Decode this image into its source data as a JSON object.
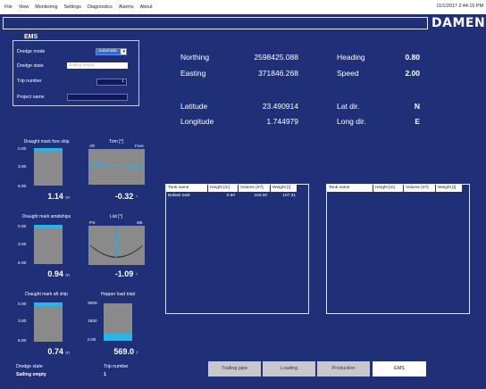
{
  "menu": {
    "items": [
      "File",
      "View",
      "Monitoring",
      "Settings",
      "Diagnostics",
      "Alarms",
      "About"
    ],
    "clock": "11/1/2017 2:44:15 PM"
  },
  "logo": {
    "text": "DAMEN"
  },
  "ems": {
    "title": "EMS",
    "dredge_mode_label": "Dredge mode",
    "dredge_mode_value": "Automatic",
    "dredge_state_label": "Dredge state",
    "dredge_state_value": "Sailing empty",
    "trip_number_label": "Trip number",
    "trip_number_value": "1",
    "project_name_label": "Project name",
    "project_name_value": ""
  },
  "navigation": {
    "northing_label": "Northing",
    "northing_value": "2598425.088",
    "easting_label": "Easting",
    "easting_value": "371846.268",
    "heading_label": "Heading",
    "heading_value": "0.80",
    "speed_label": "Speed",
    "speed_value": "2.00",
    "latitude_label": "Latitude",
    "latitude_value": "23.490914",
    "longitude_label": "Longitude",
    "longitude_value": "1.744979",
    "lat_dir_label": "Lat dir.",
    "lat_dir_value": "N",
    "long_dir_label": "Long dir.",
    "long_dir_value": "E"
  },
  "gauges": {
    "fore": {
      "label": "Draught mark fore ship",
      "ticks": [
        "0.00",
        "3.00",
        "6.00"
      ],
      "value": "1.14",
      "unit": "m",
      "fill": 0.0
    },
    "trim": {
      "label": "Trim [°]",
      "left": "Aft",
      "right": "Fore",
      "value": "-0.32",
      "unit": "°"
    },
    "amid": {
      "label": "Draught mark amidships",
      "ticks": [
        "0.00",
        "3.00",
        "6.00"
      ],
      "value": "0.94",
      "unit": "m",
      "fill": 0.1
    },
    "list": {
      "label": "List [°]",
      "left": "PS",
      "right": "SB",
      "value": "-1.09",
      "unit": "°"
    },
    "aft": {
      "label": "Draught mark aft ship",
      "ticks": [
        "0.00",
        "3.00",
        "6.00"
      ],
      "value": "0.74",
      "unit": "m",
      "fill": 0.1
    },
    "hopper": {
      "label": "Hopper load total",
      "ticks": [
        "3000",
        "1500",
        "0.00"
      ],
      "value": "569.0",
      "unit": "t",
      "fill": 0.19
    }
  },
  "tables": {
    "left": {
      "headers": [
        "Tank name",
        "Height [m]",
        "Volume [m³]",
        "Weight [t]"
      ],
      "rows": [
        [
          "Ballast tank",
          "0.60",
          "104.00",
          "107.31"
        ]
      ]
    },
    "right": {
      "headers": [
        "Tank name",
        "Height [m]",
        "Volume [m³]",
        "Weight [t]"
      ],
      "rows": []
    }
  },
  "status": {
    "dredge_state_label": "Dredge state",
    "dredge_state_value": "Sailing empty",
    "trip_number_label": "Trip number",
    "trip_number_value": "1"
  },
  "buttons": {
    "trailing_pipe": "Trailing pipe",
    "loading": "Loading",
    "production": "Production",
    "ems": "EMS"
  },
  "colors": {
    "background": "#1f2f78",
    "gauge_fill": "#21b7ea",
    "gauge_body": "#8a8a8a"
  }
}
